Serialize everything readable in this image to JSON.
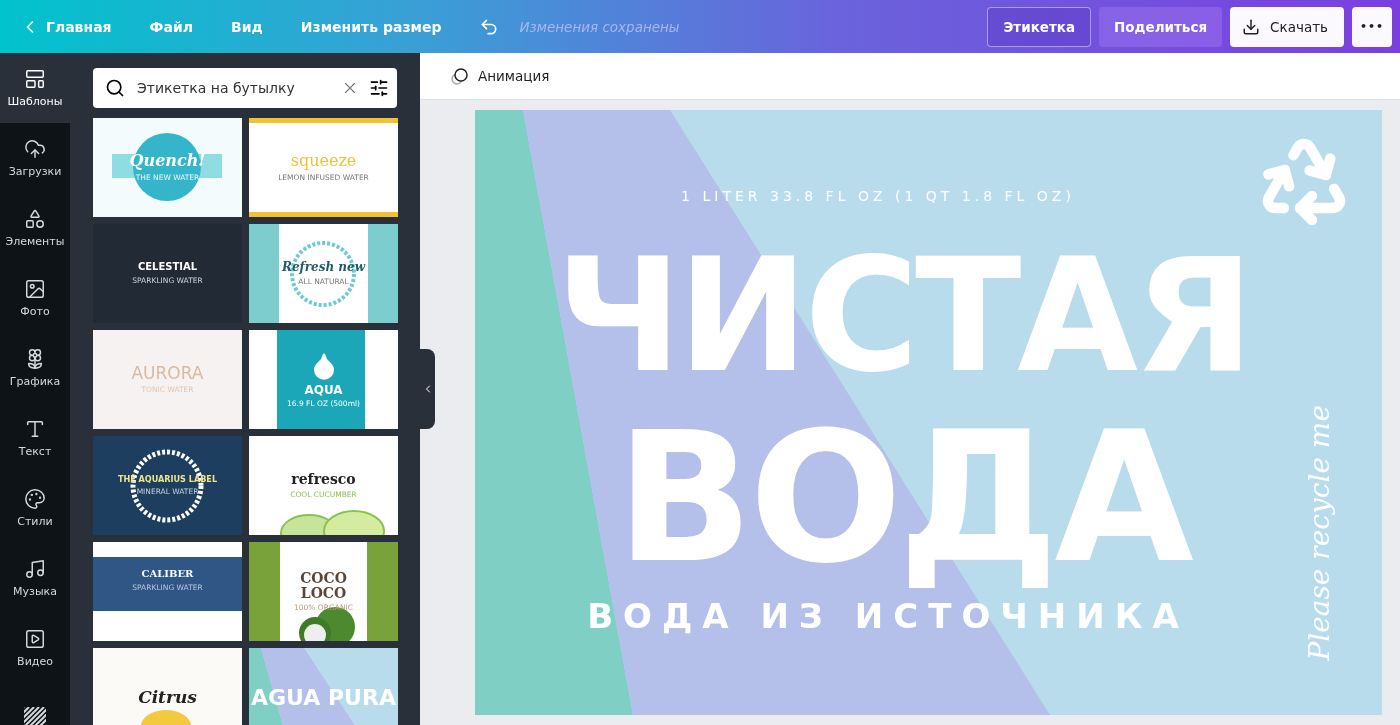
{
  "topbar": {
    "back": "Главная",
    "menu": [
      "Файл",
      "Вид",
      "Изменить размер"
    ],
    "status": "Изменения сохранены",
    "buttons": [
      {
        "label": "Этикетка",
        "kind": "outline"
      },
      {
        "label": "Поделиться",
        "kind": "soft"
      },
      {
        "label": "Скачать",
        "kind": "download"
      },
      {
        "label": "•••",
        "kind": "more"
      }
    ]
  },
  "rail": [
    {
      "label": "Шаблоны",
      "kind": "templates",
      "selected": true
    },
    {
      "label": "Загрузки",
      "kind": "upload",
      "selected": false
    },
    {
      "label": "Элементы",
      "kind": "shapes",
      "selected": false
    },
    {
      "label": "Фото",
      "kind": "photo",
      "selected": false
    },
    {
      "label": "Графика",
      "kind": "graphics",
      "selected": false
    },
    {
      "label": "Текст",
      "kind": "text",
      "selected": false
    },
    {
      "label": "Стили",
      "kind": "styles",
      "selected": false
    },
    {
      "label": "Музыка",
      "kind": "music",
      "selected": false
    },
    {
      "label": "Видео",
      "kind": "video",
      "selected": false
    },
    {
      "kind": "pattern",
      "selected": false
    }
  ],
  "search": {
    "value": "Этикетка на бутылку"
  },
  "templates": [
    {
      "kind": "quench",
      "title": "Quench!",
      "subtitle": "THE NEW WATER"
    },
    {
      "kind": "squeeze",
      "title": "squeeze",
      "subtitle": "LEMON INFUSED WATER"
    },
    {
      "kind": "celestial",
      "title": "CELESTIAL",
      "subtitle": "SPARKLING WATER"
    },
    {
      "kind": "refresh",
      "title": "Refresh new",
      "subtitle": "ALL NATURAL"
    },
    {
      "kind": "aurora",
      "title": "AURORA",
      "subtitle": "TONIC WATER"
    },
    {
      "kind": "aqua",
      "title": "AQUA",
      "subtitle": "16.9 FL OZ (500ml)"
    },
    {
      "kind": "aquarius",
      "title": "THE AQUARIUS LABEL",
      "subtitle": "MINERAL WATER"
    },
    {
      "kind": "refresco",
      "title": "refresco",
      "subtitle": "COOL CUCUMBER"
    },
    {
      "kind": "caliber",
      "title": "CALIBER",
      "subtitle": "SPARKLING WATER"
    },
    {
      "kind": "coco",
      "title": "COCO LOCO",
      "subtitle": "100% ORGANIC"
    },
    {
      "kind": "citrus",
      "title": "Citrus"
    },
    {
      "kind": "agua",
      "title": "AGUA PURA"
    }
  ],
  "toolbar": {
    "animation": "Анимация"
  },
  "design": {
    "volume": "1 LITER 33.8 FL OZ (1 QT 1.8 FL OZ)",
    "title_line_1": "ЧИСТАЯ",
    "title_line_2": "ВОДА",
    "tagline": "ВОДА ИЗ ИСТОЧНИКА",
    "side_text": "Please recycle me"
  }
}
